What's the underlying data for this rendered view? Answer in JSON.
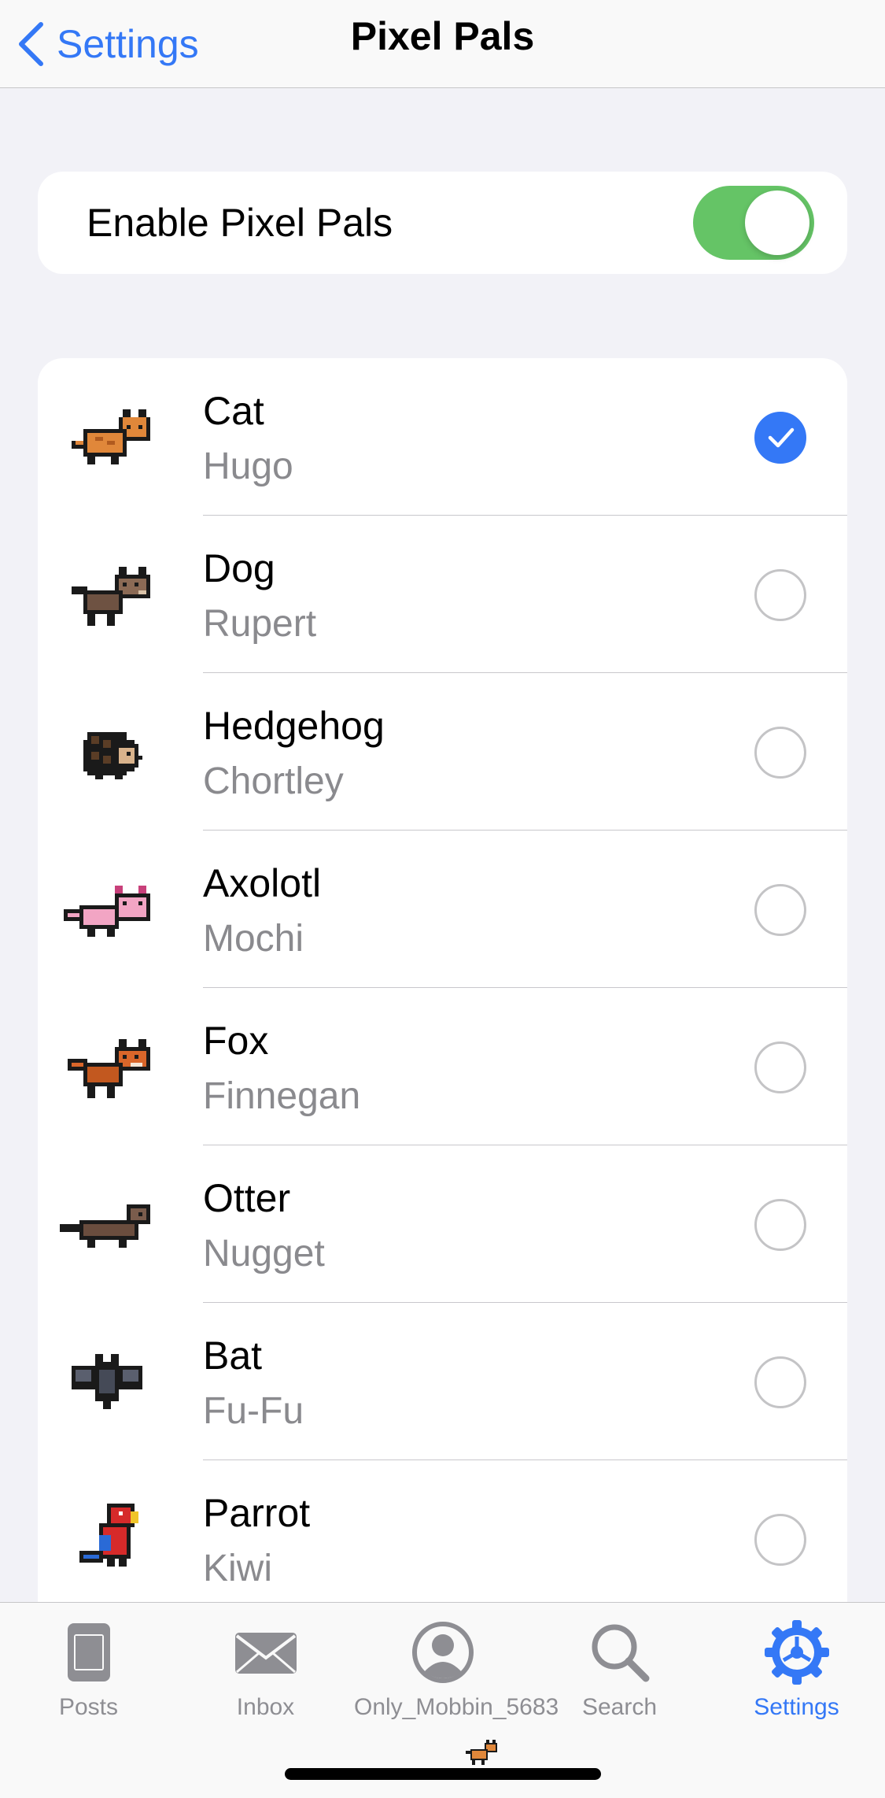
{
  "nav": {
    "back_label": "Settings",
    "title": "Pixel Pals"
  },
  "toggle": {
    "label": "Enable Pixel Pals",
    "on": true,
    "on_color": "#65c466"
  },
  "pals": [
    {
      "species": "Cat",
      "name": "Hugo",
      "selected": true,
      "icon": "cat-sprite"
    },
    {
      "species": "Dog",
      "name": "Rupert",
      "selected": false,
      "icon": "dog-sprite"
    },
    {
      "species": "Hedgehog",
      "name": "Chortley",
      "selected": false,
      "icon": "hedgehog-sprite"
    },
    {
      "species": "Axolotl",
      "name": "Mochi",
      "selected": false,
      "icon": "axolotl-sprite"
    },
    {
      "species": "Fox",
      "name": "Finnegan",
      "selected": false,
      "icon": "fox-sprite"
    },
    {
      "species": "Otter",
      "name": "Nugget",
      "selected": false,
      "icon": "otter-sprite"
    },
    {
      "species": "Bat",
      "name": "Fu-Fu",
      "selected": false,
      "icon": "bat-sprite"
    },
    {
      "species": "Parrot",
      "name": "Kiwi",
      "selected": false,
      "icon": "parrot-sprite"
    }
  ],
  "tabs": [
    {
      "label": "Posts",
      "icon": "posts-icon",
      "active": false
    },
    {
      "label": "Inbox",
      "icon": "envelope-icon",
      "active": false
    },
    {
      "label": "Only_Mobbin_5683",
      "icon": "profile-icon",
      "active": false
    },
    {
      "label": "Search",
      "icon": "search-icon",
      "active": false
    },
    {
      "label": "Settings",
      "icon": "gear-icon",
      "active": true
    }
  ],
  "colors": {
    "accent": "#3478f6",
    "background": "#f2f2f7",
    "secondary_text": "#8a8a8e"
  }
}
